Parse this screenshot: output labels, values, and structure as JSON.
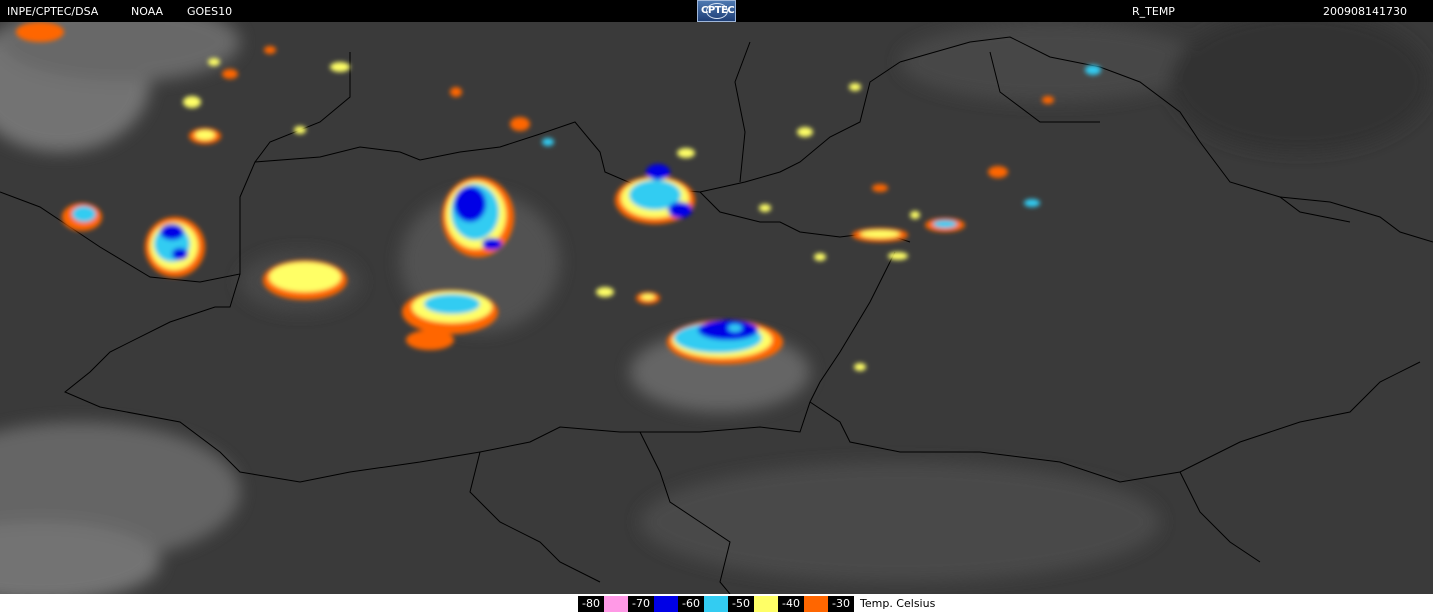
{
  "header": {
    "source": "INPE/CPTEC/DSA",
    "agency": "NOAA",
    "satellite": "GOES10",
    "logo_text": "CPTEC",
    "product": "R_TEMP",
    "timestamp": "200908141730"
  },
  "legend": {
    "items": [
      {
        "label": "-80",
        "color": "#ff99e6"
      },
      {
        "label": "-70",
        "color": "#0000e6"
      },
      {
        "label": "-60",
        "color": "#33ccf2"
      },
      {
        "label": "-50",
        "color": "#ffff66"
      },
      {
        "label": "-40",
        "color": "#ff6600"
      },
      {
        "label": "-30",
        "color": ""
      }
    ],
    "units": "Temp. Celsius"
  }
}
